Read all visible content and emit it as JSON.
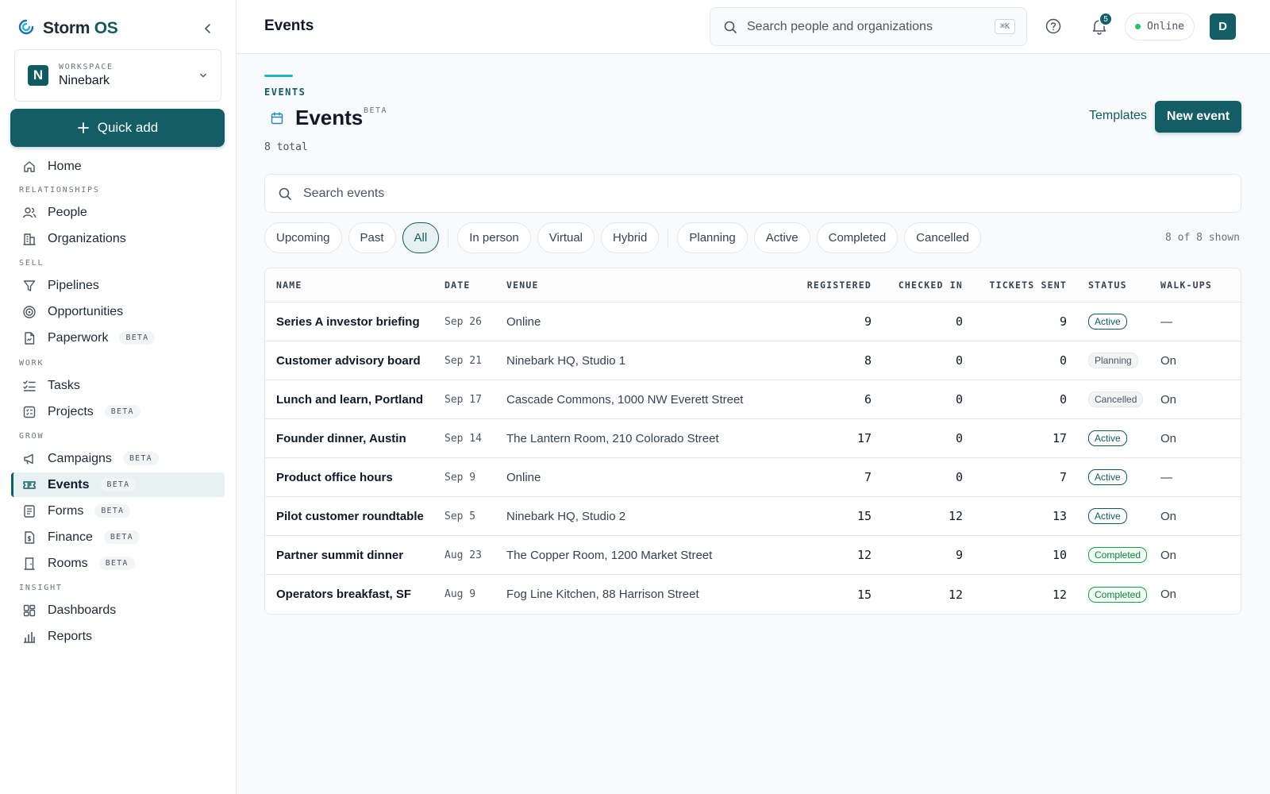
{
  "brand": {
    "name": "Storm",
    "suffix": "OS"
  },
  "workspace": {
    "label": "WORKSPACE",
    "name": "Ninebark",
    "logo_letter": "N"
  },
  "quick_add": "Quick add",
  "nav": {
    "home": "Home",
    "sections": {
      "relationships": "RELATIONSHIPS",
      "sell": "SELL",
      "work": "WORK",
      "grow": "GROW",
      "insight": "INSIGHT"
    },
    "people": "People",
    "organizations": "Organizations",
    "pipelines": "Pipelines",
    "opportunities": "Opportunities",
    "paperwork": "Paperwork",
    "tasks": "Tasks",
    "projects": "Projects",
    "campaigns": "Campaigns",
    "events": "Events",
    "forms": "Forms",
    "finance": "Finance",
    "rooms": "Rooms",
    "dashboards": "Dashboards",
    "reports": "Reports",
    "beta": "BETA"
  },
  "topbar": {
    "title": "Events",
    "search_placeholder": "Search people and organizations",
    "shortcut": "⌘K",
    "notification_count": "5",
    "status": "Online",
    "avatar_letter": "D"
  },
  "page": {
    "eyebrow": "EVENTS",
    "title": "Events",
    "title_badge": "BETA",
    "total": "8 total",
    "templates": "Templates",
    "new_event": "New event",
    "search_placeholder": "Search events",
    "shown": "8 of 8 shown"
  },
  "filters": {
    "time": [
      "Upcoming",
      "Past",
      "All"
    ],
    "format": [
      "In person",
      "Virtual",
      "Hybrid"
    ],
    "status": [
      "Planning",
      "Active",
      "Completed",
      "Cancelled"
    ],
    "active": "All"
  },
  "table": {
    "headers": {
      "name": "NAME",
      "date": "DATE",
      "venue": "VENUE",
      "registered": "REGISTERED",
      "checked_in": "CHECKED IN",
      "tickets_sent": "TICKETS SENT",
      "status": "STATUS",
      "walk_ups": "WALK-UPS"
    },
    "rows": [
      {
        "name": "Series A investor briefing",
        "date": "Sep 26",
        "venue": "Online",
        "registered": "9",
        "checked_in": "0",
        "tickets_sent": "9",
        "status": "Active",
        "walk_ups": "—"
      },
      {
        "name": "Customer advisory board",
        "date": "Sep 21",
        "venue": "Ninebark HQ, Studio 1",
        "registered": "8",
        "checked_in": "0",
        "tickets_sent": "0",
        "status": "Planning",
        "walk_ups": "On"
      },
      {
        "name": "Lunch and learn, Portland",
        "date": "Sep 17",
        "venue": "Cascade Commons, 1000 NW Everett Street",
        "registered": "6",
        "checked_in": "0",
        "tickets_sent": "0",
        "status": "Cancelled",
        "walk_ups": "On"
      },
      {
        "name": "Founder dinner, Austin",
        "date": "Sep 14",
        "venue": "The Lantern Room, 210 Colorado Street",
        "registered": "17",
        "checked_in": "0",
        "tickets_sent": "17",
        "status": "Active",
        "walk_ups": "On"
      },
      {
        "name": "Product office hours",
        "date": "Sep 9",
        "venue": "Online",
        "registered": "7",
        "checked_in": "0",
        "tickets_sent": "7",
        "status": "Active",
        "walk_ups": "—"
      },
      {
        "name": "Pilot customer roundtable",
        "date": "Sep 5",
        "venue": "Ninebark HQ, Studio 2",
        "registered": "15",
        "checked_in": "12",
        "tickets_sent": "13",
        "status": "Active",
        "walk_ups": "On"
      },
      {
        "name": "Partner summit dinner",
        "date": "Aug 23",
        "venue": "The Copper Room, 1200 Market Street",
        "registered": "12",
        "checked_in": "9",
        "tickets_sent": "10",
        "status": "Completed",
        "walk_ups": "On"
      },
      {
        "name": "Operators breakfast, SF",
        "date": "Aug 9",
        "venue": "Fog Line Kitchen, 88 Harrison Street",
        "registered": "15",
        "checked_in": "12",
        "tickets_sent": "12",
        "status": "Completed",
        "walk_ups": "On"
      }
    ]
  },
  "colors": {
    "brand": "#135e66",
    "accent": "#22b4c4",
    "online": "#22c55e",
    "completed": "#16a34a"
  }
}
